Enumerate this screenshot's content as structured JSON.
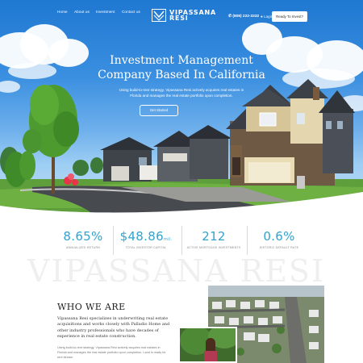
{
  "nav": {
    "links": [
      "Home",
      "About us",
      "Investment",
      "Contact us"
    ],
    "logo_line1": "VIPASSANA",
    "logo_line2": "RESI",
    "phone": "(808) 222-3332",
    "login": "Login",
    "cta": "Ready To Invest?"
  },
  "hero": {
    "title_line1": "Investment Management",
    "title_line2": "Company Based In California",
    "subtitle_line1": "Using build-to-rent strategy, Vipassana Resi actively acquires real estates in",
    "subtitle_line2": "Florida and manages the real estate portfolio upon completion.",
    "button": "Get Started"
  },
  "stats": [
    {
      "value": "8.65%",
      "suffix": "",
      "label": "ANNUALIZED RETURN"
    },
    {
      "value": "$48.86",
      "suffix": "mil.",
      "label": "TOTAL INVESTOR CAPITAL"
    },
    {
      "value": "212",
      "suffix": "",
      "label": "ACTIVE MORTGAGE INVESTMENTS"
    },
    {
      "value": "0.6%",
      "suffix": "",
      "label": "HISTORIC DEFAULT RATE"
    }
  ],
  "who": {
    "watermark": "VIPASSANA RESI",
    "title": "WHO WE ARE",
    "para1": "Vipassana Resi specializes in underwriting real estate acquisitions and works closely with Palladio Home and other industry professionals who have decades of experience in real estate construction.",
    "para2": "Using build-to-rent strategy, Vipassana Resi actively acquires real estates in Florida and manages the real estate portfolio upon completion. Land is ready for rent stream."
  },
  "colors": {
    "accent": "#31a3cf",
    "sky": "#2a80d6"
  }
}
